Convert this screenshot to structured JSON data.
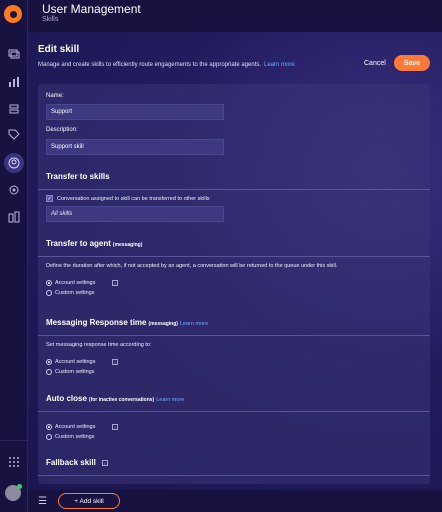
{
  "app": {
    "title": "User Management",
    "subtitle": "Skills"
  },
  "page": {
    "title": "Edit skill",
    "description": "Manage and create skills to efficiently route engagements to the appropriate agents.",
    "learn_more": "Learn more",
    "cancel_label": "Cancel",
    "save_label": "Save"
  },
  "form": {
    "name_label": "Name:",
    "name_value": "Support",
    "description_label": "Description:",
    "description_value": "Support skill"
  },
  "transfer_to_skills": {
    "title": "Transfer to skills",
    "checkbox_label": "Conversation assigned to skill can be transferred to other skills",
    "checked": true,
    "skills_value": "All skills"
  },
  "transfer_to_agent": {
    "title": "Transfer to agent",
    "qualifier": "(messaging)",
    "description": "Define the duration after which, if not accepted by an agent, a conversation will be returned to the queue under this skill.",
    "options": [
      "Account settings",
      "Custom settings"
    ],
    "selected": "Account settings"
  },
  "response_time": {
    "title": "Messaging Response time",
    "qualifier": "(messaging)",
    "learn_more": "Learn more",
    "description": "Set messaging response time according to:",
    "options": [
      "Account settings",
      "Custom settings"
    ],
    "selected": "Account settings"
  },
  "auto_close": {
    "title": "Auto close",
    "qualifier": "(for inactive conversations)",
    "learn_more": "Learn more",
    "options": [
      "Account settings",
      "Custom settings"
    ],
    "selected": "Account settings"
  },
  "fallback_skill": {
    "title": "Fallback skill"
  },
  "footer": {
    "add_skill_label": "+ Add skill"
  },
  "sidebar": {
    "icons": [
      "chat-icon",
      "analytics-icon",
      "automation-icon",
      "tag-icon",
      "user-management-icon",
      "settings-icon",
      "apps-icon"
    ],
    "active": "user-management-icon"
  },
  "colors": {
    "accent": "#ff7a3a",
    "link": "#6ab0ff",
    "background": "#1b1650"
  }
}
